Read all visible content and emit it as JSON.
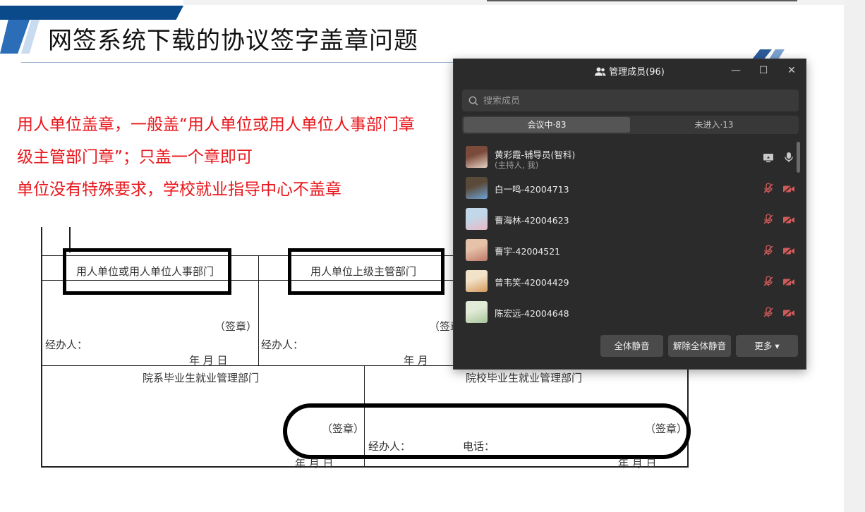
{
  "slide": {
    "title": "网签系统下载的协议签字盖章问题",
    "lines": [
      "用人单位盖章，一般盖“用人单位或用人单位人事部门章",
      "级主管部门章”；只盖一个章即可",
      "单位没有特殊要求，学校就业指导中心不盖章"
    ],
    "form": {
      "col1_header": "用人单位或用人单位人事部门",
      "col2_header": "用人单位上级主管部门",
      "seal1": "（签章）",
      "seal2": "（签章",
      "handler1": "经办人：",
      "handler2": "经办人：",
      "date1": "年    月    日",
      "date2": "年    月",
      "dept_header": "院系毕业生就业管理部门",
      "school_header": "院校毕业生就业管理部门",
      "seal3": "（签章）",
      "seal4": "（签章）",
      "handler3": "经办人：",
      "phone": "电话：",
      "date3": "年    月    日",
      "date4": "年    月    日"
    }
  },
  "panel": {
    "title": "管理成员(96)",
    "search_placeholder": "搜索成员",
    "tabs": [
      {
        "label": "会议中·83",
        "active": true
      },
      {
        "label": "未进入·13",
        "active": false
      }
    ],
    "members": [
      {
        "name": "黄彩霞-辅导员(智科)",
        "sub": "(主持人, 我)",
        "mic": "on",
        "icon2": "screen-share-icon",
        "colors": [
          "#e8d2c4",
          "#7a4a3a"
        ]
      },
      {
        "name": "白一鸣-42004713",
        "mic": "muted",
        "icon2": "video-off-icon",
        "colors": [
          "#6ea3d6",
          "#5a4a3a"
        ]
      },
      {
        "name": "曹海林-42004623",
        "mic": "muted",
        "icon2": "video-off-icon",
        "colors": [
          "#e8b7c6",
          "#c2d8e8"
        ]
      },
      {
        "name": "曹宇-42004521",
        "mic": "muted",
        "icon2": "video-off-icon",
        "colors": [
          "#c07a6a",
          "#e6c2a8"
        ]
      },
      {
        "name": "曾韦笑-42004429",
        "mic": "muted",
        "icon2": "video-off-icon",
        "colors": [
          "#d49a5a",
          "#f2e2c8"
        ]
      },
      {
        "name": "陈宏远-42004648",
        "mic": "muted",
        "icon2": "video-off-icon",
        "colors": [
          "#a8c49a",
          "#e2ebd8"
        ]
      }
    ],
    "buttons": {
      "mute_all": "全体静音",
      "unmute_all": "解除全体静音",
      "more": "更多 ▾"
    },
    "win_controls": {
      "minimize": "—",
      "maximize": "☐",
      "close": "✕"
    }
  },
  "colors": {
    "accent_red": "#e8161b",
    "panel_bg": "#2b2b2b",
    "muted_red": "#e05555"
  }
}
